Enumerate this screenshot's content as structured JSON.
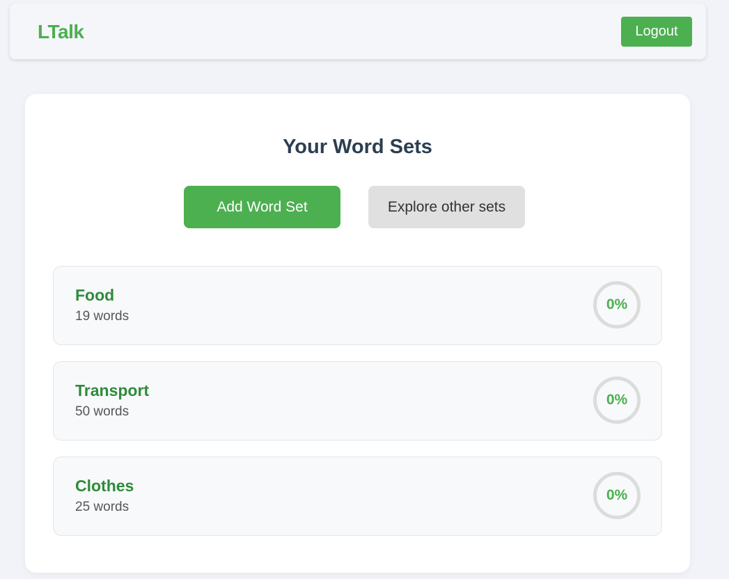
{
  "navbar": {
    "logo": "LTalk",
    "logout_label": "Logout"
  },
  "main": {
    "title": "Your Word Sets",
    "add_button_label": "Add Word Set",
    "explore_button_label": "Explore other sets",
    "word_sets": [
      {
        "name": "Food",
        "count": "19 words",
        "progress": "0%"
      },
      {
        "name": "Transport",
        "count": "50 words",
        "progress": "0%"
      },
      {
        "name": "Clothes",
        "count": "25 words",
        "progress": "0%"
      }
    ]
  },
  "colors": {
    "accent": "#4caf50",
    "set_name": "#2e8b3a",
    "title": "#2c3e50",
    "secondary_button": "#e0e0e0",
    "background": "#f2f3f8"
  }
}
